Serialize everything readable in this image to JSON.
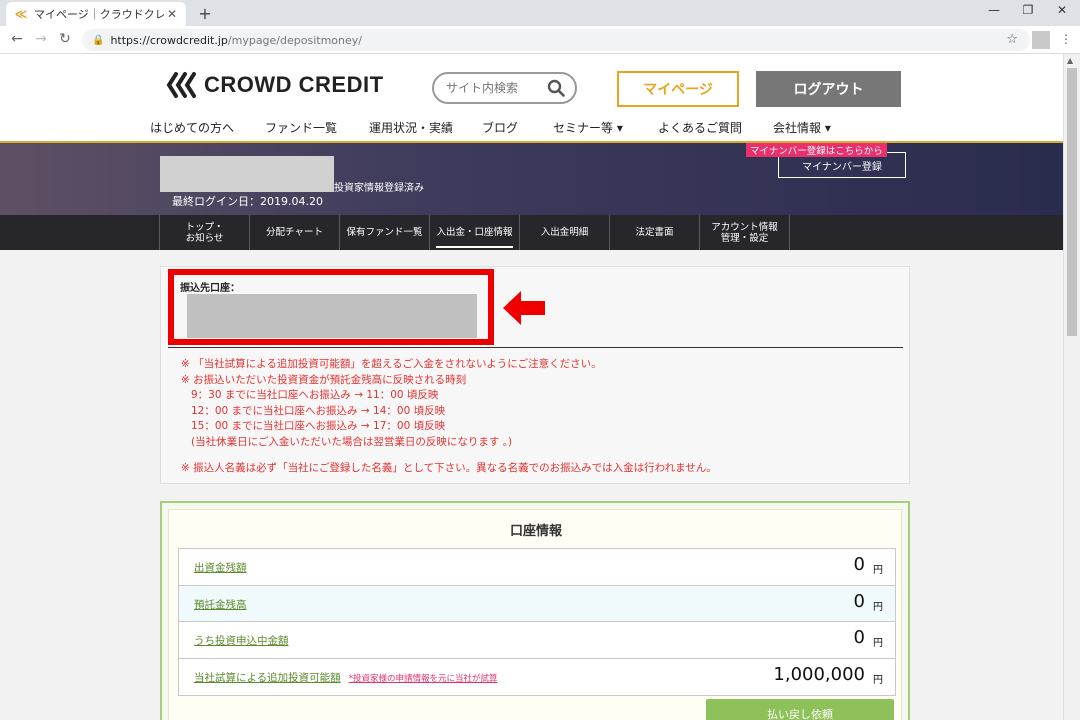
{
  "browser": {
    "tab_title": "マイページ｜クラウドクレジット",
    "url_host": "https://crowdcredit.jp",
    "url_path": "/mypage/depositmoney/"
  },
  "header": {
    "logo_text": "CROWD CREDIT",
    "search_placeholder": "サイト内検索",
    "mypage_label": "マイページ",
    "logout_label": "ログアウト",
    "nav": [
      {
        "label": "はじめての方へ"
      },
      {
        "label": "ファンド一覧"
      },
      {
        "label": "運用状況・実績"
      },
      {
        "label": "ブログ"
      },
      {
        "label": "セミナー等 ▾"
      },
      {
        "label": "よくあるご質問"
      },
      {
        "label": "会社情報 ▾"
      }
    ]
  },
  "banner": {
    "status_text": "投資家情報登録済み",
    "last_login": "最終ログイン日：2019.04.20",
    "mynumber_tip": "マイナンバー登録はこちらから",
    "mynumber_button": "マイナンバー登録"
  },
  "subnav": [
    {
      "label": "トップ・\nお知らせ"
    },
    {
      "label": "分配チャート"
    },
    {
      "label": "保有ファンド一覧"
    },
    {
      "label": "入出金・口座情報"
    },
    {
      "label": "入出金明細"
    },
    {
      "label": "法定書面"
    },
    {
      "label": "アカウント情報\n管理・設定"
    }
  ],
  "deposit": {
    "account_label": "振込先口座：",
    "notes": [
      "※ 「当社試算による追加投資可能額」を超えるご入金をされないようにご注意ください。",
      "※ お振込いただいた投資資金が預託金残高に反映される時刻",
      "9：30 までに当社口座へお振込み → 11：00 頃反映",
      "12：00 までに当社口座へお振込み → 14：00 頃反映",
      "15：00 までに当社口座へお振込み → 17：00 頃反映",
      "(当社休業日にご入金いただいた場合は翌営業日の反映になります 。)"
    ],
    "note_last": "※ 振込人名義は必ず「当社にご登録した名義」として下さい。異なる名義でのお振込みでは入金は行われません。"
  },
  "account_info": {
    "title": "口座情報",
    "rows": [
      {
        "label": "出資金残額",
        "value": "0",
        "unit": "円",
        "sub": ""
      },
      {
        "label": "預託金残高",
        "value": "0",
        "unit": "円",
        "sub": ""
      },
      {
        "label": "うち投資申込中金額",
        "value": "0",
        "unit": "円",
        "sub": ""
      },
      {
        "label": "当社試算による追加投資可能額",
        "value": "1,000,000",
        "unit": "円",
        "sub": "*投資家様の申請情報を元に当社が試算"
      }
    ],
    "refund_button": "払い戻し依頼"
  },
  "colors": {
    "accent_gold": "#d4ad33",
    "mypage_orange": "#e8a321",
    "notice_red": "#e53232",
    "highlight_red": "#ee0000",
    "link_green": "#5a8a2a",
    "pink": "#e8306d"
  }
}
